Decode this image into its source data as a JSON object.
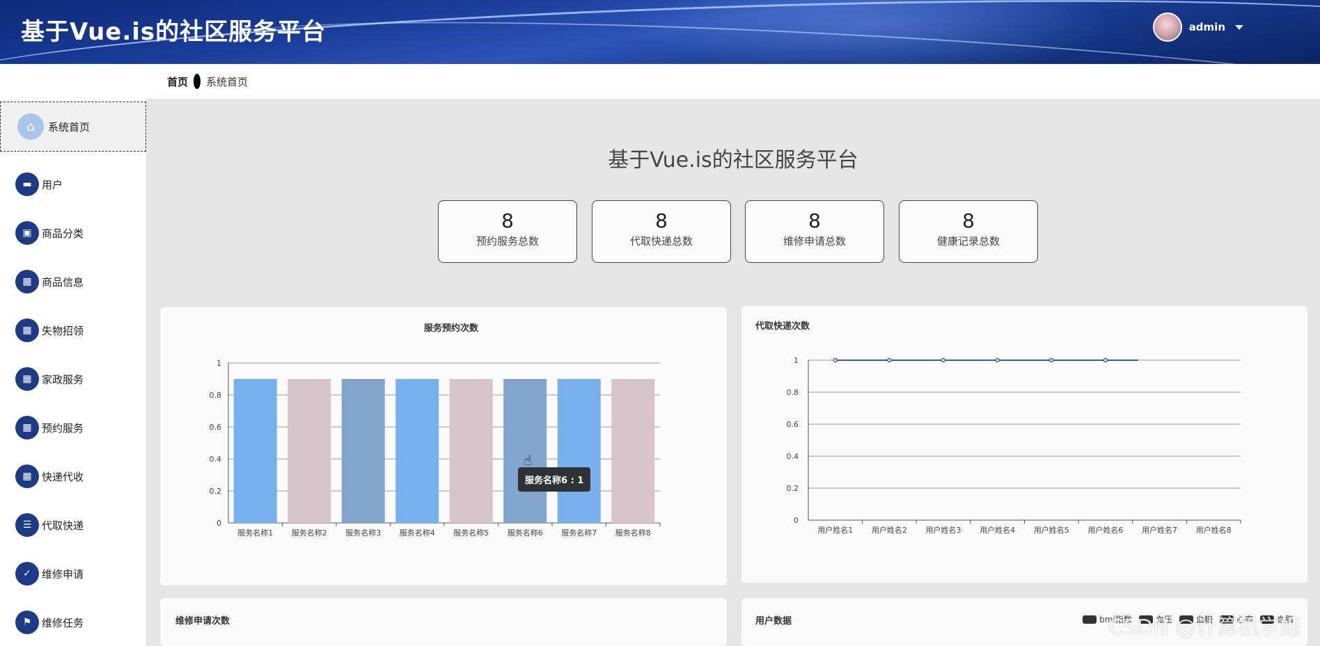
{
  "header": {
    "title": "基于Vue.is的社区服务平台",
    "user": "admin"
  },
  "breadcrumb": {
    "home": "首页",
    "current": "系统首页"
  },
  "sidebar": {
    "home": "系统首页",
    "items": [
      {
        "label": "用户",
        "icon": "chat-icon"
      },
      {
        "label": "商品分类",
        "icon": "clipboard-x-icon"
      },
      {
        "label": "商品信息",
        "icon": "grid-icon"
      },
      {
        "label": "失物招领",
        "icon": "grid-icon"
      },
      {
        "label": "家政服务",
        "icon": "grid-icon"
      },
      {
        "label": "预约服务",
        "icon": "grid-icon"
      },
      {
        "label": "快递代收",
        "icon": "grid-icon"
      },
      {
        "label": "代取快递",
        "icon": "list-icon"
      },
      {
        "label": "维修申请",
        "icon": "clipboard-check-icon"
      },
      {
        "label": "维修任务",
        "icon": "flag-icon"
      }
    ]
  },
  "main": {
    "title": "基于Vue.is的社区服务平台",
    "stats": [
      {
        "value": "8",
        "label": "预约服务总数"
      },
      {
        "value": "8",
        "label": "代取快递总数"
      },
      {
        "value": "8",
        "label": "维修申请总数"
      },
      {
        "value": "8",
        "label": "健康记录总数"
      }
    ]
  },
  "panels": {
    "repair_title": "维修申请次数",
    "user_title": "用户数据",
    "legend": [
      "bmi指数",
      "血压",
      "血糖",
      "心率",
      "血脂"
    ],
    "watermark": "CSDN @计算机学姐"
  },
  "tooltip": "服务名称6 : 1",
  "colors": {
    "bar_blue": "#78b0ee",
    "bar_pink": "#d8c5cc",
    "bar_steel": "#82a5cd",
    "line": "#3a5a8c"
  },
  "chart_data": [
    {
      "type": "bar",
      "title": "服务预约次数",
      "categories": [
        "服务名称1",
        "服务名称2",
        "服务名称3",
        "服务名称4",
        "服务名称5",
        "服务名称6",
        "服务名称7",
        "服务名称8"
      ],
      "values": [
        1,
        1,
        1,
        1,
        1,
        1,
        1,
        1
      ],
      "ylim": [
        0,
        1
      ],
      "yticks": [
        "0",
        "0.2",
        "0.4",
        "0.6",
        "0.8",
        "1"
      ],
      "grid": true
    },
    {
      "type": "line",
      "title": "代取快递次数",
      "categories": [
        "用户姓名1",
        "用户姓名2",
        "用户姓名3",
        "用户姓名4",
        "用户姓名5",
        "用户姓名6",
        "用户姓名7",
        "用户姓名8"
      ],
      "values": [
        1,
        1,
        1,
        1,
        1,
        1
      ],
      "ylim": [
        0,
        1
      ],
      "yticks": [
        "0",
        "0.2",
        "0.4",
        "0.6",
        "0.8",
        "1"
      ],
      "grid": true
    }
  ]
}
